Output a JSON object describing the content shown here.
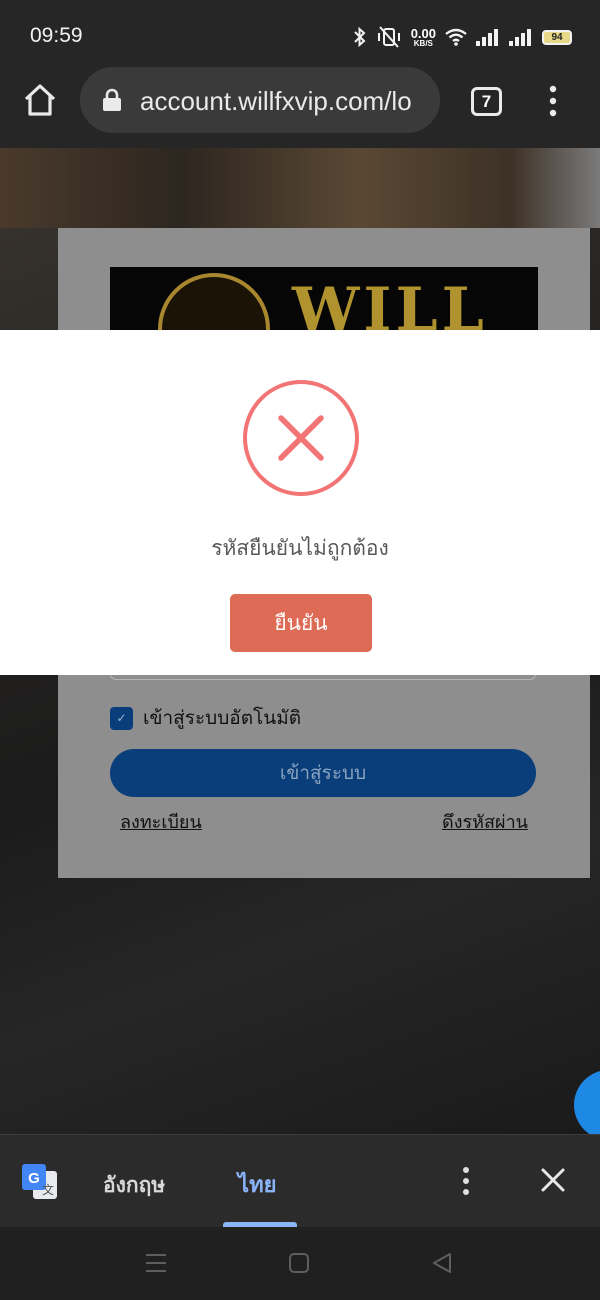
{
  "status_bar": {
    "time": "09:59",
    "net_speed_value": "0.00",
    "net_speed_unit": "KB/S",
    "battery": "94"
  },
  "browser": {
    "url": "account.willfxvip.com/lo",
    "tab_count": "7"
  },
  "login_card": {
    "logo_text": "WILL",
    "auto_login_label": "เข้าสู่ระบบอัตโนมัติ",
    "login_button": "เข้าสู่ระบบ",
    "register_link": "ลงทะเบียน",
    "recover_password_link": "ดึงรหัสผ่าน"
  },
  "modal": {
    "message": "รหัสยืนยันไม่ถูกต้อง",
    "confirm_button": "ยืนยัน",
    "error_color": "#F27474",
    "button_color": "#DD6B55"
  },
  "translate_bar": {
    "source_language": "อังกฤษ",
    "target_language": "ไทย",
    "selected": "ไทย"
  }
}
